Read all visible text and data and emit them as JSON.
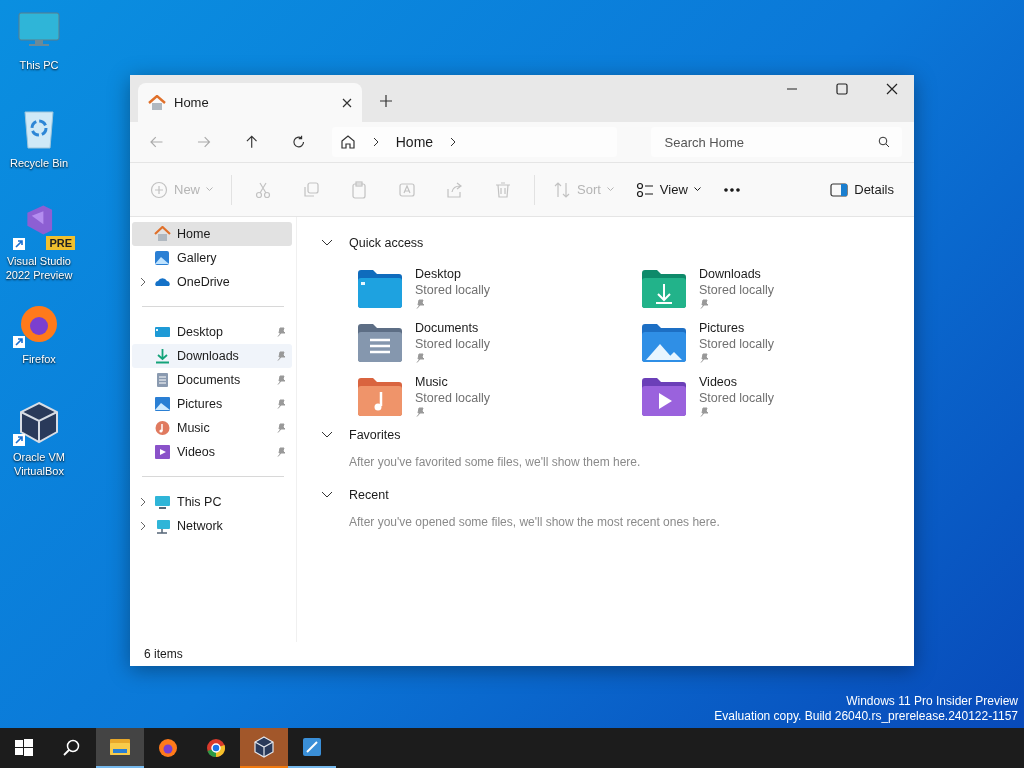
{
  "desktop_icons": [
    {
      "label": "This PC",
      "kind": "pc",
      "shortcut": false
    },
    {
      "label": "Recycle Bin",
      "kind": "bin",
      "shortcut": false
    },
    {
      "label": "Visual Studio 2022 Preview",
      "kind": "vs",
      "shortcut": true,
      "badge": "PRE"
    },
    {
      "label": "Firefox",
      "kind": "firefox",
      "shortcut": true
    },
    {
      "label": "Oracle VM VirtualBox",
      "kind": "vbox",
      "shortcut": true
    }
  ],
  "window": {
    "tabs": [
      {
        "title": "Home",
        "selected": true
      }
    ],
    "breadcrumb": [
      "Home"
    ],
    "search": {
      "placeholder": "Search Home"
    },
    "toolbar": [
      {
        "kind": "new",
        "label": "New",
        "disabled": true,
        "dropdown": true
      },
      {
        "kind": "cut",
        "disabled": true,
        "dropdown": false
      },
      {
        "kind": "copy",
        "disabled": true,
        "dropdown": false
      },
      {
        "kind": "paste",
        "disabled": true,
        "dropdown": false
      },
      {
        "kind": "rename",
        "disabled": true,
        "dropdown": false
      },
      {
        "kind": "share",
        "disabled": true,
        "dropdown": false
      },
      {
        "kind": "delete",
        "disabled": true,
        "dropdown": false
      },
      {
        "kind": "sort",
        "label": "Sort",
        "disabled": true,
        "dropdown": true
      },
      {
        "kind": "view",
        "label": "View",
        "disabled": false,
        "dropdown": true
      },
      {
        "kind": "more",
        "disabled": false,
        "dropdown": false
      }
    ],
    "details": {
      "label": "Details"
    },
    "sidebar": [
      [
        {
          "label": "Home",
          "kind": "home",
          "expandable": false,
          "pinned": false,
          "selected": true,
          "hovered": false
        },
        {
          "label": "Gallery",
          "kind": "gallery",
          "expandable": false,
          "pinned": false,
          "selected": false,
          "hovered": false
        },
        {
          "label": "OneDrive",
          "kind": "cloud",
          "expandable": true,
          "pinned": false,
          "selected": false,
          "hovered": false
        }
      ],
      [
        {
          "label": "Desktop",
          "kind": "desktop",
          "expandable": false,
          "pinned": true,
          "selected": false,
          "hovered": false
        },
        {
          "label": "Downloads",
          "kind": "downloads",
          "expandable": false,
          "pinned": true,
          "selected": false,
          "hovered": true
        },
        {
          "label": "Documents",
          "kind": "documents",
          "expandable": false,
          "pinned": true,
          "selected": false,
          "hovered": false
        },
        {
          "label": "Pictures",
          "kind": "pictures",
          "expandable": false,
          "pinned": true,
          "selected": false,
          "hovered": false
        },
        {
          "label": "Music",
          "kind": "music",
          "expandable": false,
          "pinned": true,
          "selected": false,
          "hovered": false
        },
        {
          "label": "Videos",
          "kind": "videos",
          "expandable": false,
          "pinned": true,
          "selected": false,
          "hovered": false
        }
      ],
      [
        {
          "label": "This PC",
          "kind": "pc",
          "expandable": true,
          "pinned": false,
          "selected": false,
          "hovered": false
        },
        {
          "label": "Network",
          "kind": "network",
          "expandable": true,
          "pinned": false,
          "selected": false,
          "hovered": false
        }
      ]
    ],
    "sections": [
      {
        "title": "Quick access",
        "expanded": true,
        "items": [
          {
            "name": "Desktop",
            "detail": "Stored locally",
            "kind": "desktop",
            "pinned": true
          },
          {
            "name": "Downloads",
            "detail": "Stored locally",
            "kind": "downloads",
            "pinned": true
          },
          {
            "name": "Documents",
            "detail": "Stored locally",
            "kind": "documents",
            "pinned": true
          },
          {
            "name": "Pictures",
            "detail": "Stored locally",
            "kind": "pictures",
            "pinned": true
          },
          {
            "name": "Music",
            "detail": "Stored locally",
            "kind": "music",
            "pinned": true
          },
          {
            "name": "Videos",
            "detail": "Stored locally",
            "kind": "videos",
            "pinned": true
          }
        ]
      },
      {
        "title": "Favorites",
        "expanded": true,
        "message": "After you've favorited some files, we'll show them here."
      },
      {
        "title": "Recent",
        "expanded": true,
        "message": "After you've opened some files, we'll show the most recent ones here."
      }
    ],
    "status": "6 items"
  },
  "evaluation": [
    "Windows 11 Pro Insider Preview",
    "Evaluation copy. Build 26040.rs_prerelease.240122-1157"
  ],
  "taskbar": [
    {
      "kind": "start",
      "open": false,
      "selected": false,
      "flashing": false
    },
    {
      "kind": "search",
      "open": false,
      "selected": false,
      "flashing": false
    },
    {
      "kind": "explorer",
      "open": true,
      "selected": true,
      "flashing": false
    },
    {
      "kind": "firefox",
      "open": false,
      "selected": false,
      "flashing": false
    },
    {
      "kind": "chrome",
      "open": false,
      "selected": false,
      "flashing": false
    },
    {
      "kind": "vbox",
      "open": true,
      "selected": false,
      "flashing": true
    },
    {
      "kind": "tablet",
      "open": true,
      "selected": false,
      "flashing": false
    }
  ]
}
